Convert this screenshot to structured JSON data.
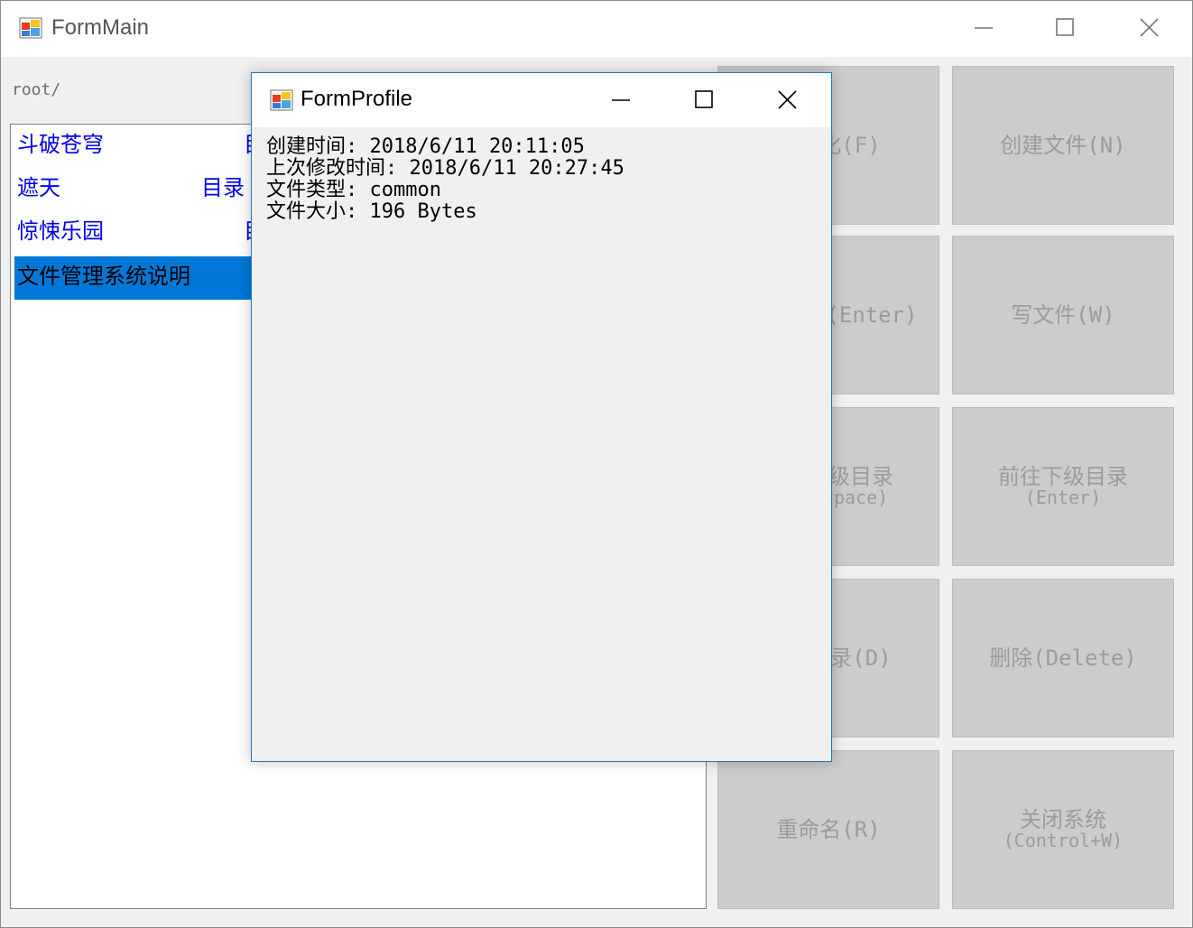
{
  "main_window": {
    "title": "FormMain",
    "path": "root/",
    "files": [
      {
        "name": "斗破苍穹",
        "type": "目录",
        "selected": false
      },
      {
        "name": "遮天",
        "type": "目录",
        "selected": false
      },
      {
        "name": "惊悚乐园",
        "type": "目录",
        "selected": false
      },
      {
        "name": "文件管理系统说明",
        "type": "",
        "selected": true
      }
    ],
    "buttons": [
      {
        "label": "格式化(F)",
        "sub": ""
      },
      {
        "label": "创建文件(N)",
        "sub": ""
      },
      {
        "label": "打开文件(Enter)",
        "sub": ""
      },
      {
        "label": "写文件(W)",
        "sub": ""
      },
      {
        "label": "返回上级目录",
        "sub": "(Backspace)"
      },
      {
        "label": "前往下级目录",
        "sub": "(Enter)"
      },
      {
        "label": "创建目录(D)",
        "sub": ""
      },
      {
        "label": "删除(Delete)",
        "sub": ""
      },
      {
        "label": "重命名(R)",
        "sub": ""
      },
      {
        "label": "关闭系统",
        "sub": "(Control+W)"
      }
    ]
  },
  "profile_window": {
    "title": "FormProfile",
    "lines": [
      "创建时间: 2018/6/11 20:11:05",
      "上次修改时间: 2018/6/11 20:27:45",
      "文件类型: common",
      "文件大小: 196 Bytes"
    ]
  },
  "icons": [
    "app-icon",
    "minimize-icon",
    "maximize-icon",
    "close-icon"
  ],
  "colors": {
    "selection": "#0078d7",
    "link": "#0000ee",
    "button_bg": "#cccccc",
    "dialog_border": "#1979ca"
  }
}
